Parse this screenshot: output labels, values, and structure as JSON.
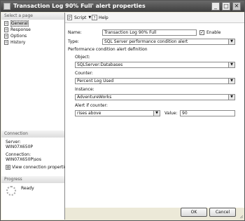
{
  "window": {
    "title": "Transaction Log 90% Full' alert properties"
  },
  "titlebar_buttons": {
    "minimize": "_",
    "maximize": "□",
    "close": "✕"
  },
  "left_pane": {
    "select_page_header": "Select a page",
    "pages": [
      {
        "label": "General",
        "icon": "page-icon",
        "selected": true
      },
      {
        "label": "Response",
        "icon": "page-icon",
        "selected": false
      },
      {
        "label": "Options",
        "icon": "page-icon",
        "selected": false
      },
      {
        "label": "History",
        "icon": "page-icon",
        "selected": false
      }
    ],
    "connection_header": "Connection",
    "server_label": "Server:",
    "server_value": "WIN07X650P",
    "connection_label": "Connection:",
    "connection_value": "WIN07X650P\\sos",
    "view_connection_link": "View connection properties",
    "progress_header": "Progress",
    "progress_status": "Ready"
  },
  "toolbar": {
    "script_label": "Script",
    "help_label": "Help"
  },
  "form": {
    "name_label": "Name:",
    "name_value": "Transaction Log 90% Full",
    "enable_label": "Enable",
    "enable_checked": true,
    "type_label": "Type:",
    "type_value": "SQL Server performance condition alert",
    "section_heading": "Performance condition alert definition",
    "object_label": "Object:",
    "object_value": "SQLServer:Databases",
    "counter_label": "Counter:",
    "counter_value": "Percent Log Used",
    "instance_label": "Instance:",
    "instance_value": "AdventureWorks",
    "alert_if_label": "Alert if counter:",
    "alert_if_value": "rises above",
    "value_label": "Value:",
    "value_value": "90"
  },
  "footer": {
    "ok_label": "OK",
    "cancel_label": "Cancel"
  }
}
